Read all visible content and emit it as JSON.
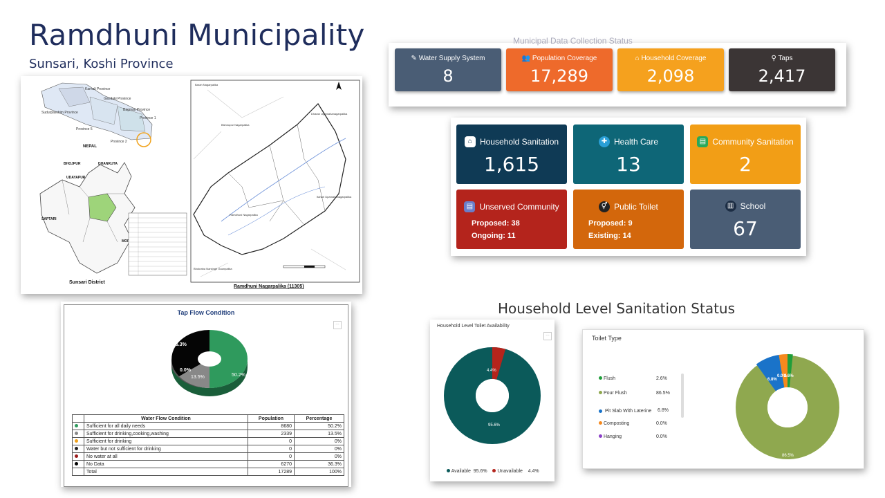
{
  "header": {
    "title": "Ramdhuni Municipality",
    "subtitle": "Sunsari, Koshi Province"
  },
  "map": {
    "nepal_label": "NEPAL",
    "district_label": "Sunsari District",
    "caption": "Ramdhuni Nagarpalika (11305)",
    "provinces": [
      "Karnali Province",
      "Gandaki Province",
      "Bagmati Province",
      "Sudurpaschim Province",
      "Province 5",
      "Province 2",
      "Province 1"
    ],
    "neighbors": [
      "BHOJPUR",
      "DHANKUTA",
      "UDAYAPUR",
      "SAPTARI",
      "MOR"
    ],
    "places": [
      "Barah Nagarpalika",
      "Bishnupur Nagarpalika",
      "Dharan Upamahanagarpalika",
      "Itahari Upamahanagarpalika",
      "Ramdhuni Nagarpalika",
      "Bhokraha Narsingh Gaunpalika"
    ]
  },
  "kpi_top": {
    "cut_title": "Municipal Data Collection Status",
    "cards": [
      {
        "label": "Water Supply System",
        "value": "8",
        "color": "#4a5d75",
        "icon": "edit-icon"
      },
      {
        "label": "Population Coverage",
        "value": "17,289",
        "color": "#ee6a2b",
        "icon": "users-icon"
      },
      {
        "label": "Household Coverage",
        "value": "2,098",
        "color": "#f5a11e",
        "icon": "home-icon"
      },
      {
        "label": "Taps",
        "value": "2,417",
        "color": "#3b3535",
        "icon": "tap-icon"
      }
    ]
  },
  "kpi_grid": {
    "household_sanitation": {
      "label": "Household Sanitation",
      "value": "1,615",
      "color": "#0f3a55"
    },
    "health_care": {
      "label": "Health Care",
      "value": "13",
      "color": "#0e6677"
    },
    "community_sanitation": {
      "label": "Community Sanitation",
      "value": "2",
      "color": "#f29e16"
    },
    "unserved_community": {
      "label": "Unserved Community",
      "proposed": "Proposed: 38",
      "ongoing": "Ongoing: 11",
      "color": "#b4241c"
    },
    "public_toilet": {
      "label": "Public Toilet",
      "proposed": "Proposed: 9",
      "existing": "Existing: 14",
      "color": "#d3670c"
    },
    "school": {
      "label": "School",
      "value": "67",
      "color": "#4a5d75"
    }
  },
  "tap_flow": {
    "title": "Tap Flow Condition",
    "pie_labels": [
      "36.3%",
      "50.2%",
      "13.5%",
      "0.0%"
    ],
    "table_headers": [
      "Water Flow Condition",
      "Population",
      "Percentage"
    ],
    "rows": [
      {
        "condition": "Sufficient for all daily needs",
        "population": "8680",
        "percentage": "50.2%",
        "color": "#2f9a5d"
      },
      {
        "condition": "Sufficient for drinking,cooking,washing",
        "population": "2339",
        "percentage": "13.5%",
        "color": "#888888"
      },
      {
        "condition": "Sufficient for drinking",
        "population": "0",
        "percentage": "0%",
        "color": "#f0a21b"
      },
      {
        "condition": "Water but not sufficient for drinking",
        "population": "0",
        "percentage": "0%",
        "color": "#222222"
      },
      {
        "condition": "No water at all",
        "population": "0",
        "percentage": "0%",
        "color": "#9b1c1c"
      },
      {
        "condition": "No Data",
        "population": "6270",
        "percentage": "36.3%",
        "color": "#000000"
      },
      {
        "condition": "Total",
        "population": "17289",
        "percentage": "100%",
        "color": ""
      }
    ]
  },
  "sanitation": {
    "heading": "Household Level Sanitation Status",
    "availability": {
      "title": "Household Level Toilet Availability",
      "legend": [
        {
          "label": "Available",
          "value": "95.6%",
          "color": "#0b5a5a"
        },
        {
          "label": "Unavailable",
          "value": "4.4%",
          "color": "#b4241c"
        }
      ],
      "slice_labels": [
        "95.6%",
        "4.4%"
      ]
    },
    "toilet_type": {
      "title": "Toilet Type",
      "legend": [
        {
          "label": "Flush",
          "value": "2.6%",
          "color": "#1f9e3a"
        },
        {
          "label": "Pour Flush",
          "value": "86.5%",
          "color": "#8fa84f"
        },
        {
          "label": "Pit Slab With Laterine",
          "value": "6.8%",
          "color": "#1a73c9"
        },
        {
          "label": "Composting",
          "value": "0.0%",
          "color": "#f5891e"
        },
        {
          "label": "Hanging",
          "value": "0.0%",
          "color": "#8a3fc7"
        }
      ],
      "slice_labels": [
        "86.5%",
        "6.8%",
        "0.0%",
        "2.6%"
      ]
    }
  }
}
